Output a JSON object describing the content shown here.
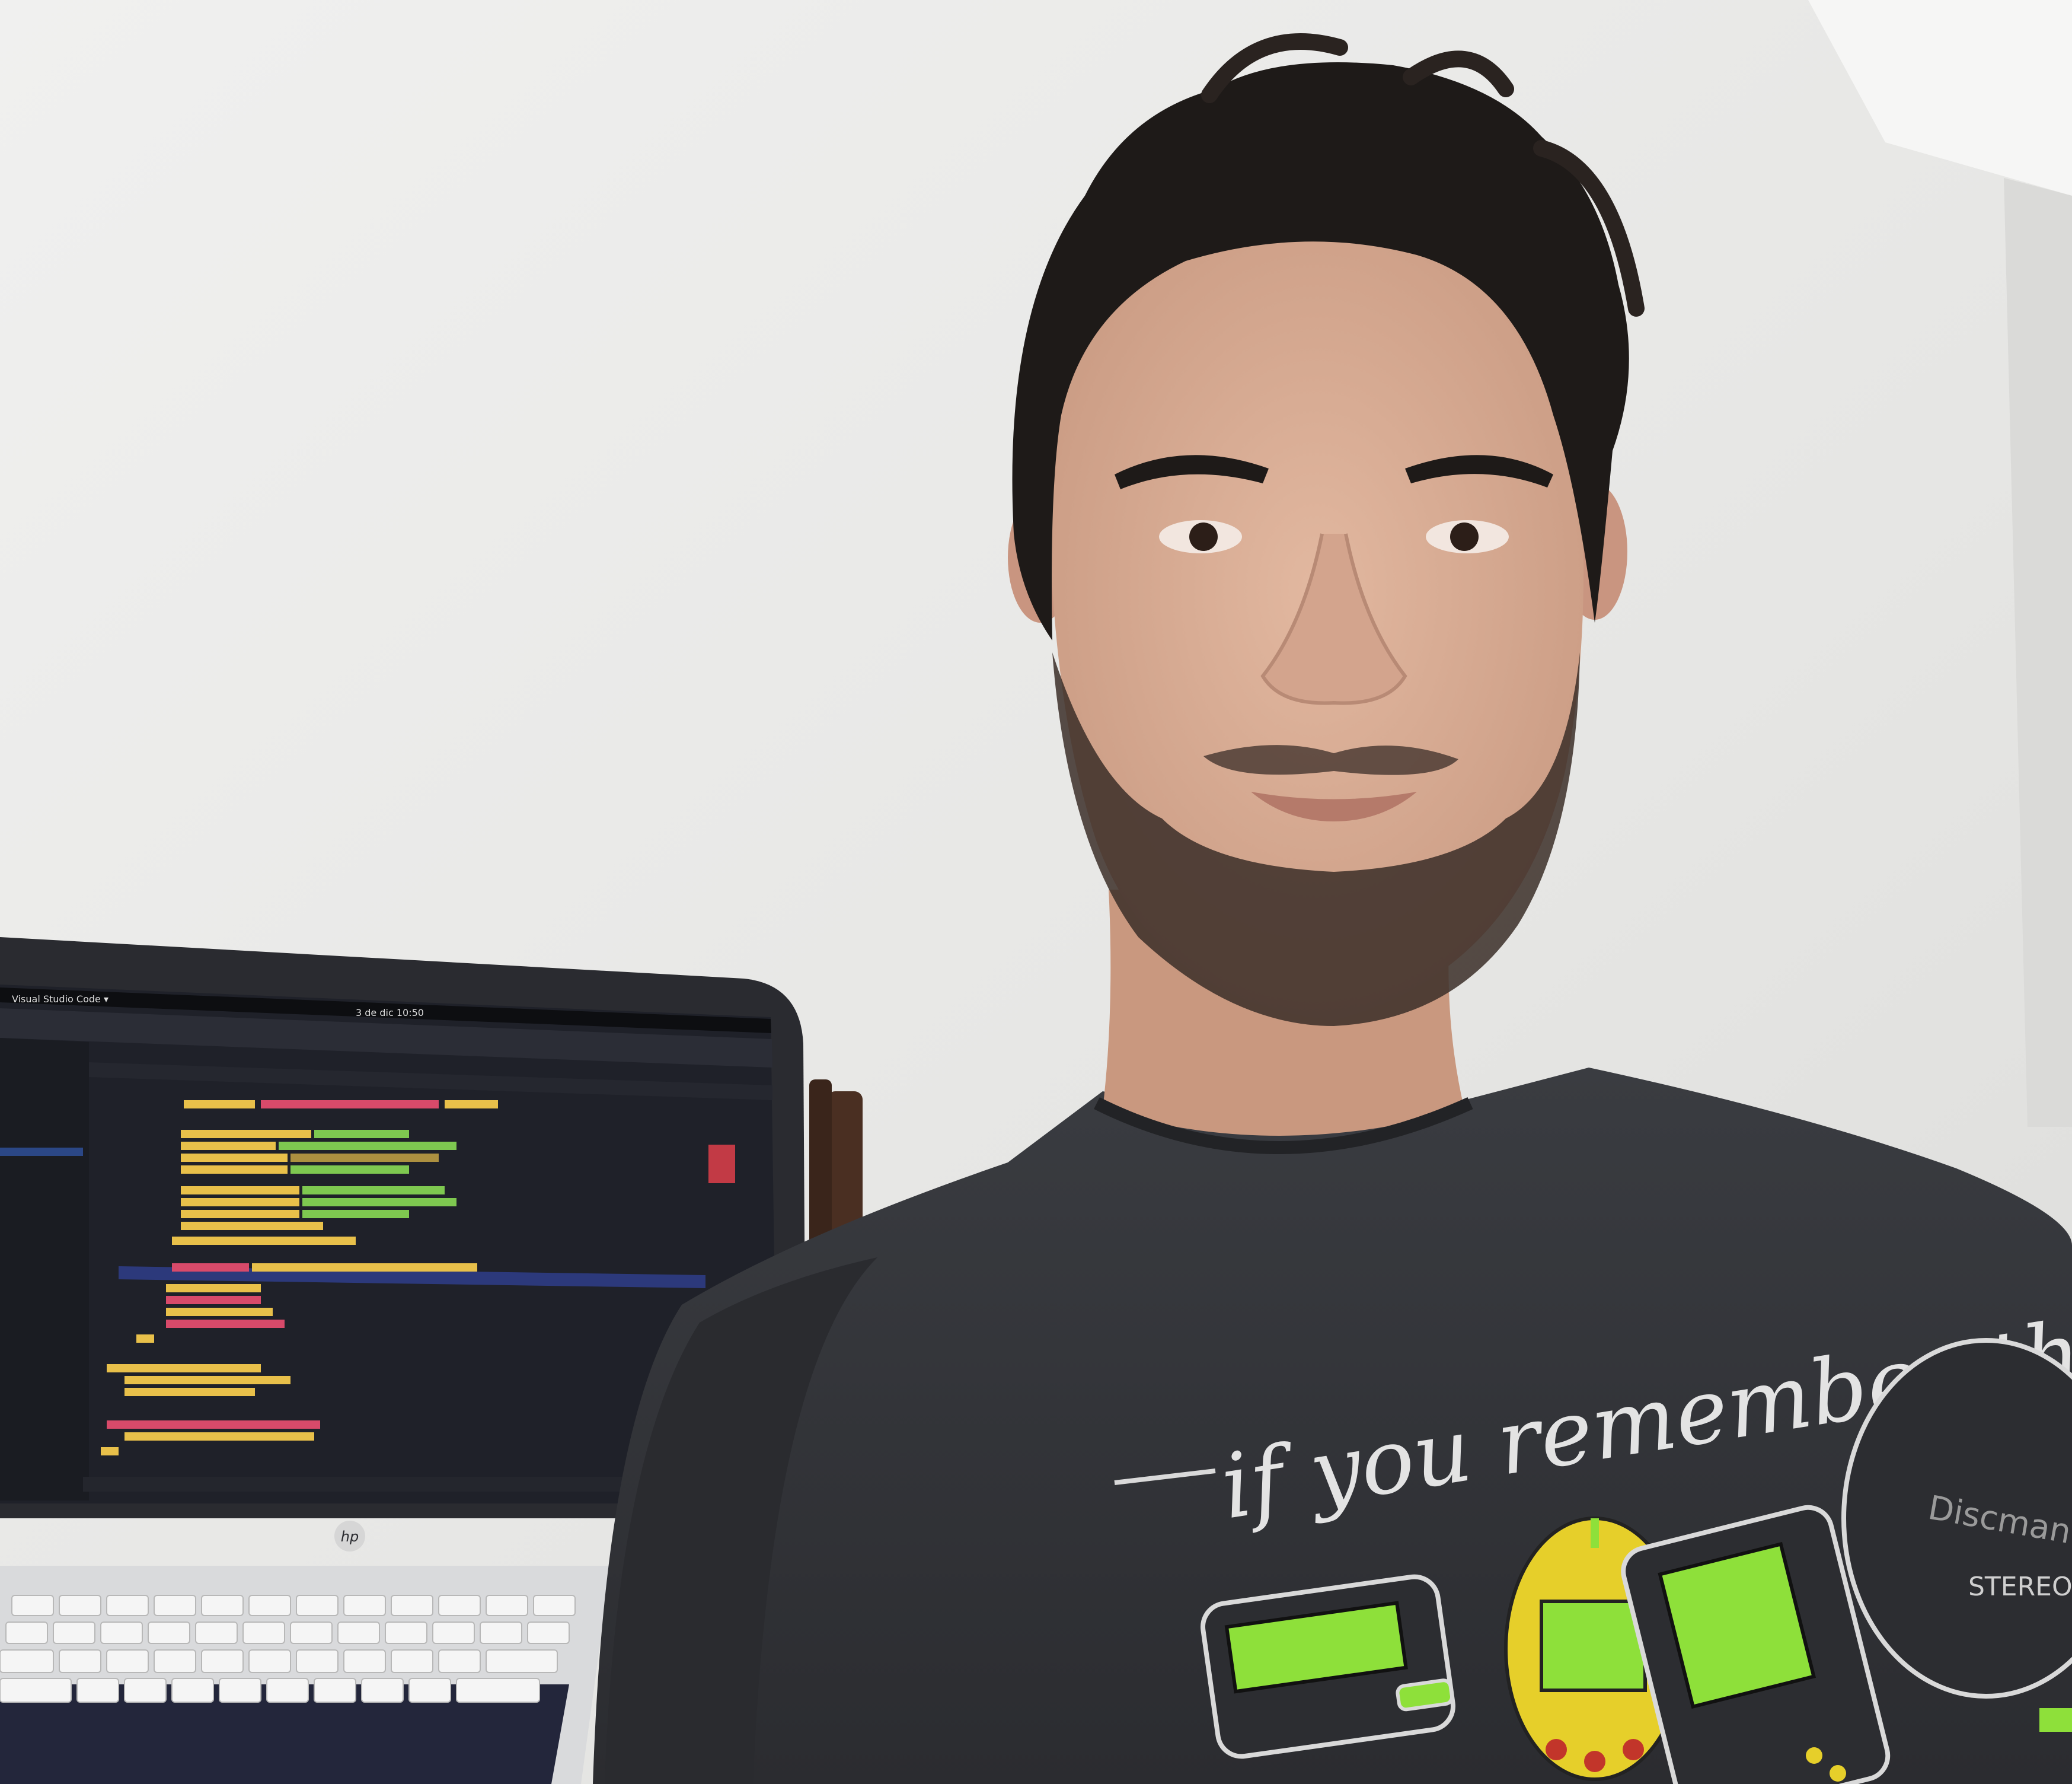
{
  "laptop": {
    "app_menu": "Visual Studio Code ▾",
    "clock": "3 de dic 10:50",
    "brand_logo": "hp"
  },
  "shirt": {
    "slogan_line": "if you remember this",
    "device_label_left": "Discman",
    "device_label_right": "STEREO"
  },
  "colors": {
    "wall": "#ebebea",
    "shirt": "#34363a",
    "hair": "#1e1a18",
    "skin": "#d9ab93",
    "editor_bg": "#1f2129",
    "lcd_green": "#8ee03a",
    "tamagotchi_yellow": "#e6cf2a"
  }
}
